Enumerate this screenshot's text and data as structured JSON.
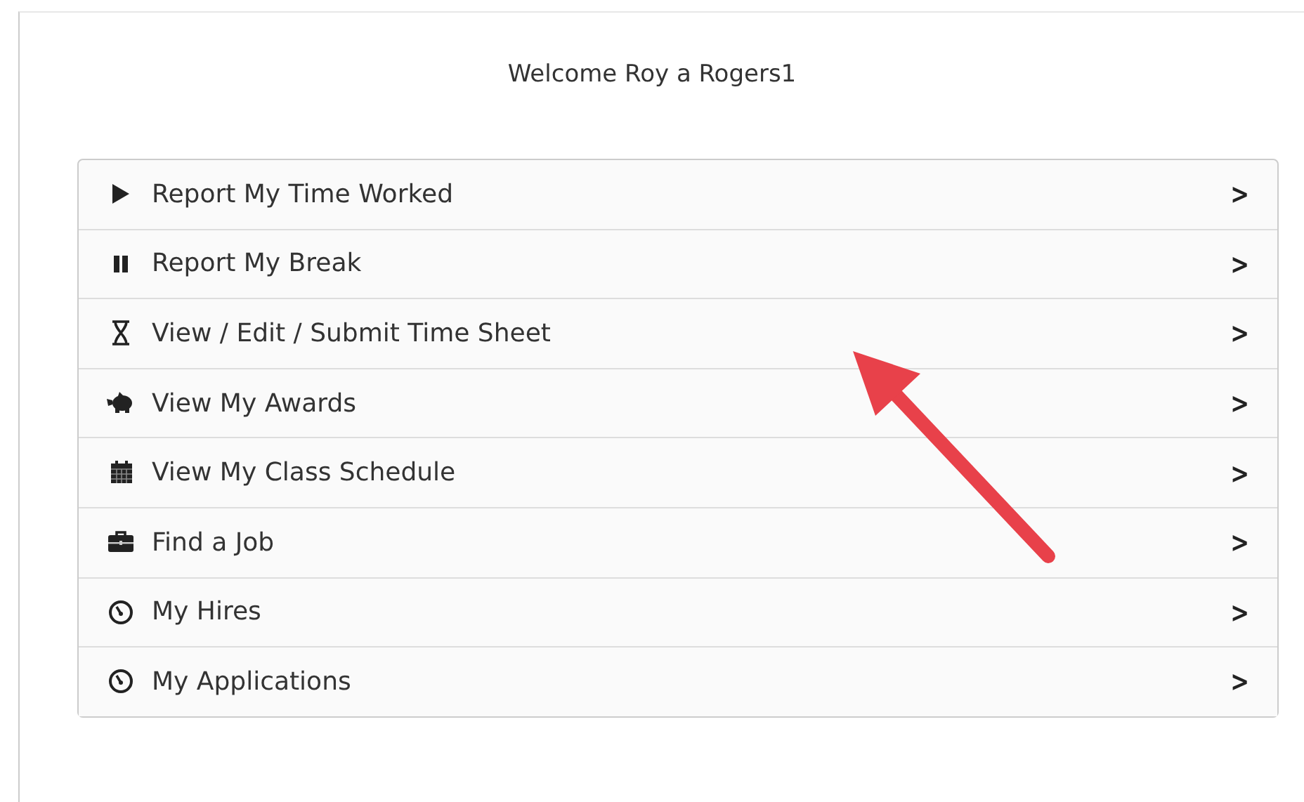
{
  "welcome": "Welcome Roy a Rogers1",
  "menu": [
    {
      "kind": "play",
      "label": "Report My Time Worked",
      "chevron": ">"
    },
    {
      "kind": "pause",
      "label": "Report My Break",
      "chevron": ">"
    },
    {
      "kind": "hourglass",
      "label": "View / Edit / Submit Time Sheet",
      "chevron": ">"
    },
    {
      "kind": "piggy",
      "label": "View My Awards",
      "chevron": ">"
    },
    {
      "kind": "calendar",
      "label": "View My Class Schedule",
      "chevron": ">"
    },
    {
      "kind": "briefcase",
      "label": "Find a Job",
      "chevron": ">"
    },
    {
      "kind": "gauge",
      "label": "My Hires",
      "chevron": ">"
    },
    {
      "kind": "gauge",
      "label": "My Applications",
      "chevron": ">"
    }
  ]
}
